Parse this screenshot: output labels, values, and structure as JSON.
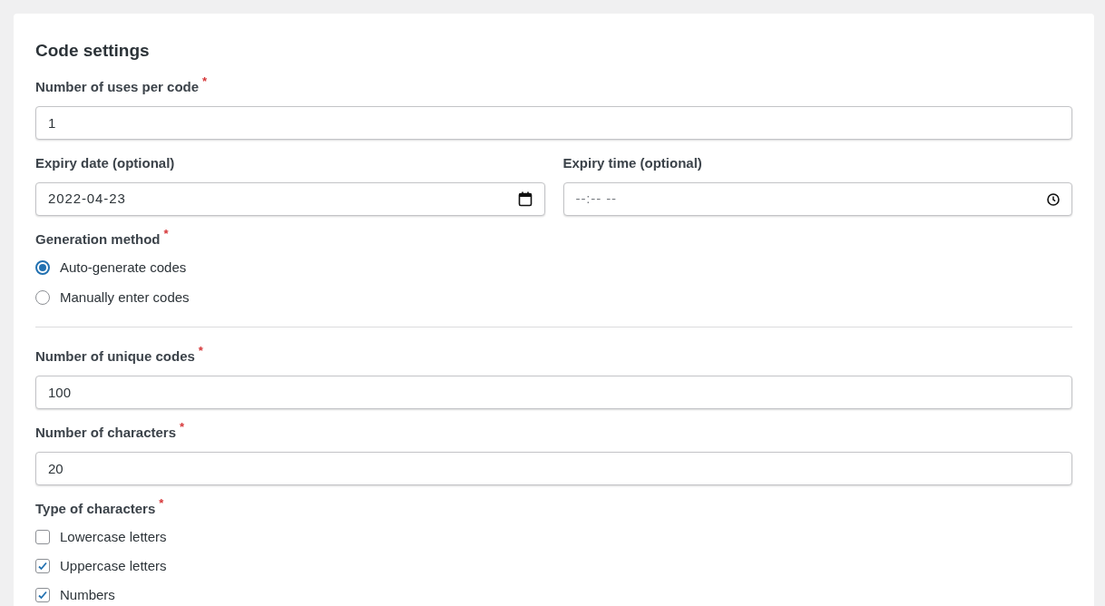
{
  "title": "Code settings",
  "uses_per_code": {
    "label": "Number of uses per code",
    "required_mark": "*",
    "value": "1"
  },
  "expiry_date": {
    "label": "Expiry date (optional)",
    "value": "2022-04-23"
  },
  "expiry_time": {
    "label": "Expiry time (optional)",
    "placeholder": "--:-- --"
  },
  "generation_method": {
    "label": "Generation method",
    "required_mark": "*",
    "options": [
      {
        "label": "Auto-generate codes",
        "selected": true
      },
      {
        "label": "Manually enter codes",
        "selected": false
      }
    ]
  },
  "unique_codes": {
    "label": "Number of unique codes",
    "required_mark": "*",
    "value": "100"
  },
  "characters": {
    "label": "Number of characters",
    "required_mark": "*",
    "value": "20"
  },
  "character_types": {
    "label": "Type of characters",
    "required_mark": "*",
    "options": [
      {
        "label": "Lowercase letters",
        "checked": false
      },
      {
        "label": "Uppercase letters",
        "checked": true
      },
      {
        "label": "Numbers",
        "checked": true
      }
    ]
  }
}
